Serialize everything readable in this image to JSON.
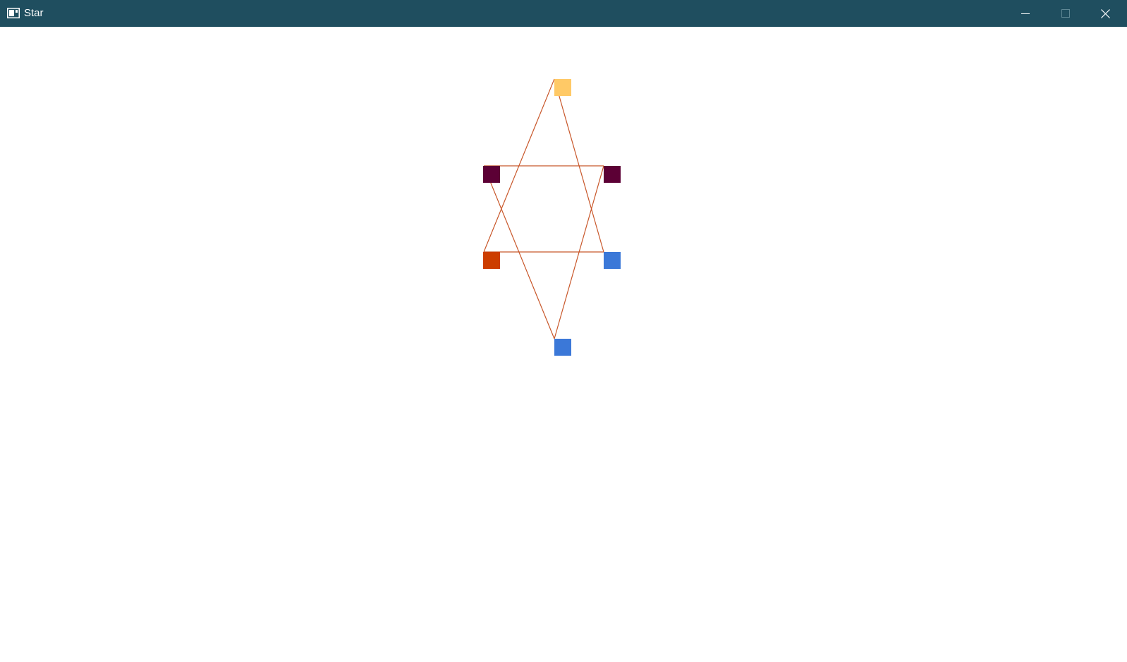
{
  "window": {
    "title": "Star",
    "titlebar_color": "#1f4e5f",
    "controls": {
      "minimize_icon": "minimize-icon",
      "maximize_icon": "maximize-icon",
      "close_icon": "close-icon"
    }
  },
  "drawing": {
    "line_color": "#c8572a",
    "vertices": [
      {
        "id": "top",
        "color": "#ffc966"
      },
      {
        "id": "upper-left",
        "color": "#5c0035"
      },
      {
        "id": "upper-right",
        "color": "#5c0035"
      },
      {
        "id": "lower-left",
        "color": "#cc3d00"
      },
      {
        "id": "lower-right",
        "color": "#3b78d8"
      },
      {
        "id": "bottom",
        "color": "#3b78d8"
      }
    ]
  }
}
